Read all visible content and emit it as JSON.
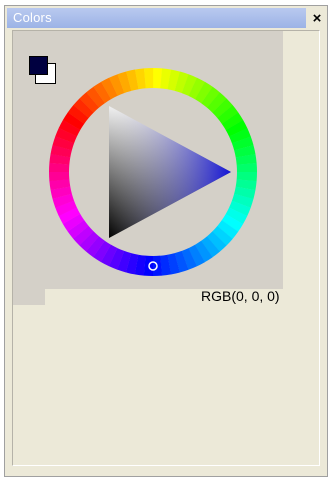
{
  "window": {
    "title": "Colors",
    "close_label": "×"
  },
  "color_picker": {
    "foreground_color": "#000040",
    "background_color": "#ffffff",
    "hue_color": "#1212d6",
    "rgb_readout": "RGB(0, 0, 0)"
  }
}
